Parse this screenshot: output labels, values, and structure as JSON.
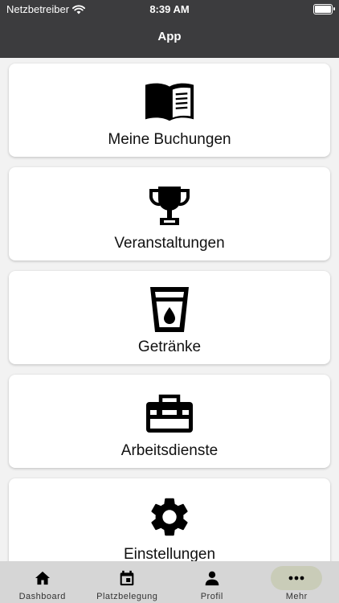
{
  "status_bar": {
    "carrier": "Netzbetreiber",
    "time": "8:39 AM"
  },
  "app_bar": {
    "title": "App"
  },
  "menu_items": [
    {
      "label": "Meine Buchungen",
      "icon": "book-icon"
    },
    {
      "label": "Veranstaltungen",
      "icon": "trophy-icon"
    },
    {
      "label": "Getränke",
      "icon": "drink-cup-icon"
    },
    {
      "label": "Arbeitsdienste",
      "icon": "toolbox-icon"
    },
    {
      "label": "Einstellungen",
      "icon": "gear-icon"
    }
  ],
  "tab_bar": {
    "items": [
      {
        "label": "Dashboard",
        "icon": "home-icon",
        "active": false
      },
      {
        "label": "Platzbelegung",
        "icon": "calendar-icon",
        "active": false
      },
      {
        "label": "Profil",
        "icon": "person-icon",
        "active": false
      },
      {
        "label": "Mehr",
        "icon": "more-icon",
        "active": true
      }
    ]
  },
  "colors": {
    "header": "#3c3c3e",
    "tabbar": "#d6d6d6",
    "active_tab_pill": "#c9ccb8",
    "background": "#f2f2f2"
  }
}
